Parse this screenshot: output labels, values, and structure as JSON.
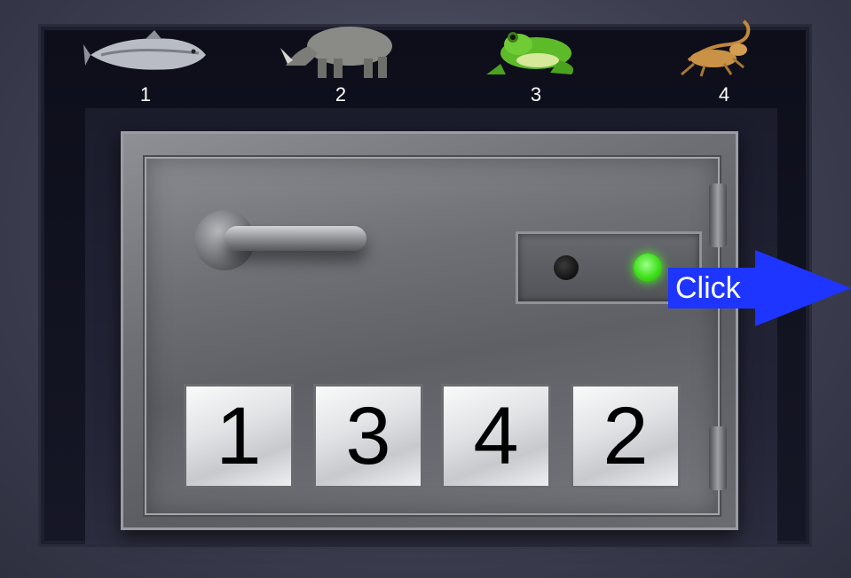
{
  "animals": [
    {
      "name": "salmon",
      "number": "1"
    },
    {
      "name": "rhinoceros",
      "number": "2"
    },
    {
      "name": "frog",
      "number": "3"
    },
    {
      "name": "lizard",
      "number": "4"
    }
  ],
  "safe": {
    "code": [
      "1",
      "3",
      "4",
      "2"
    ],
    "indicator_red": "off",
    "indicator_green": "on",
    "indicator_color": "#3ee01a"
  },
  "click_button": {
    "label": "Click",
    "color": "#1e35ff"
  }
}
